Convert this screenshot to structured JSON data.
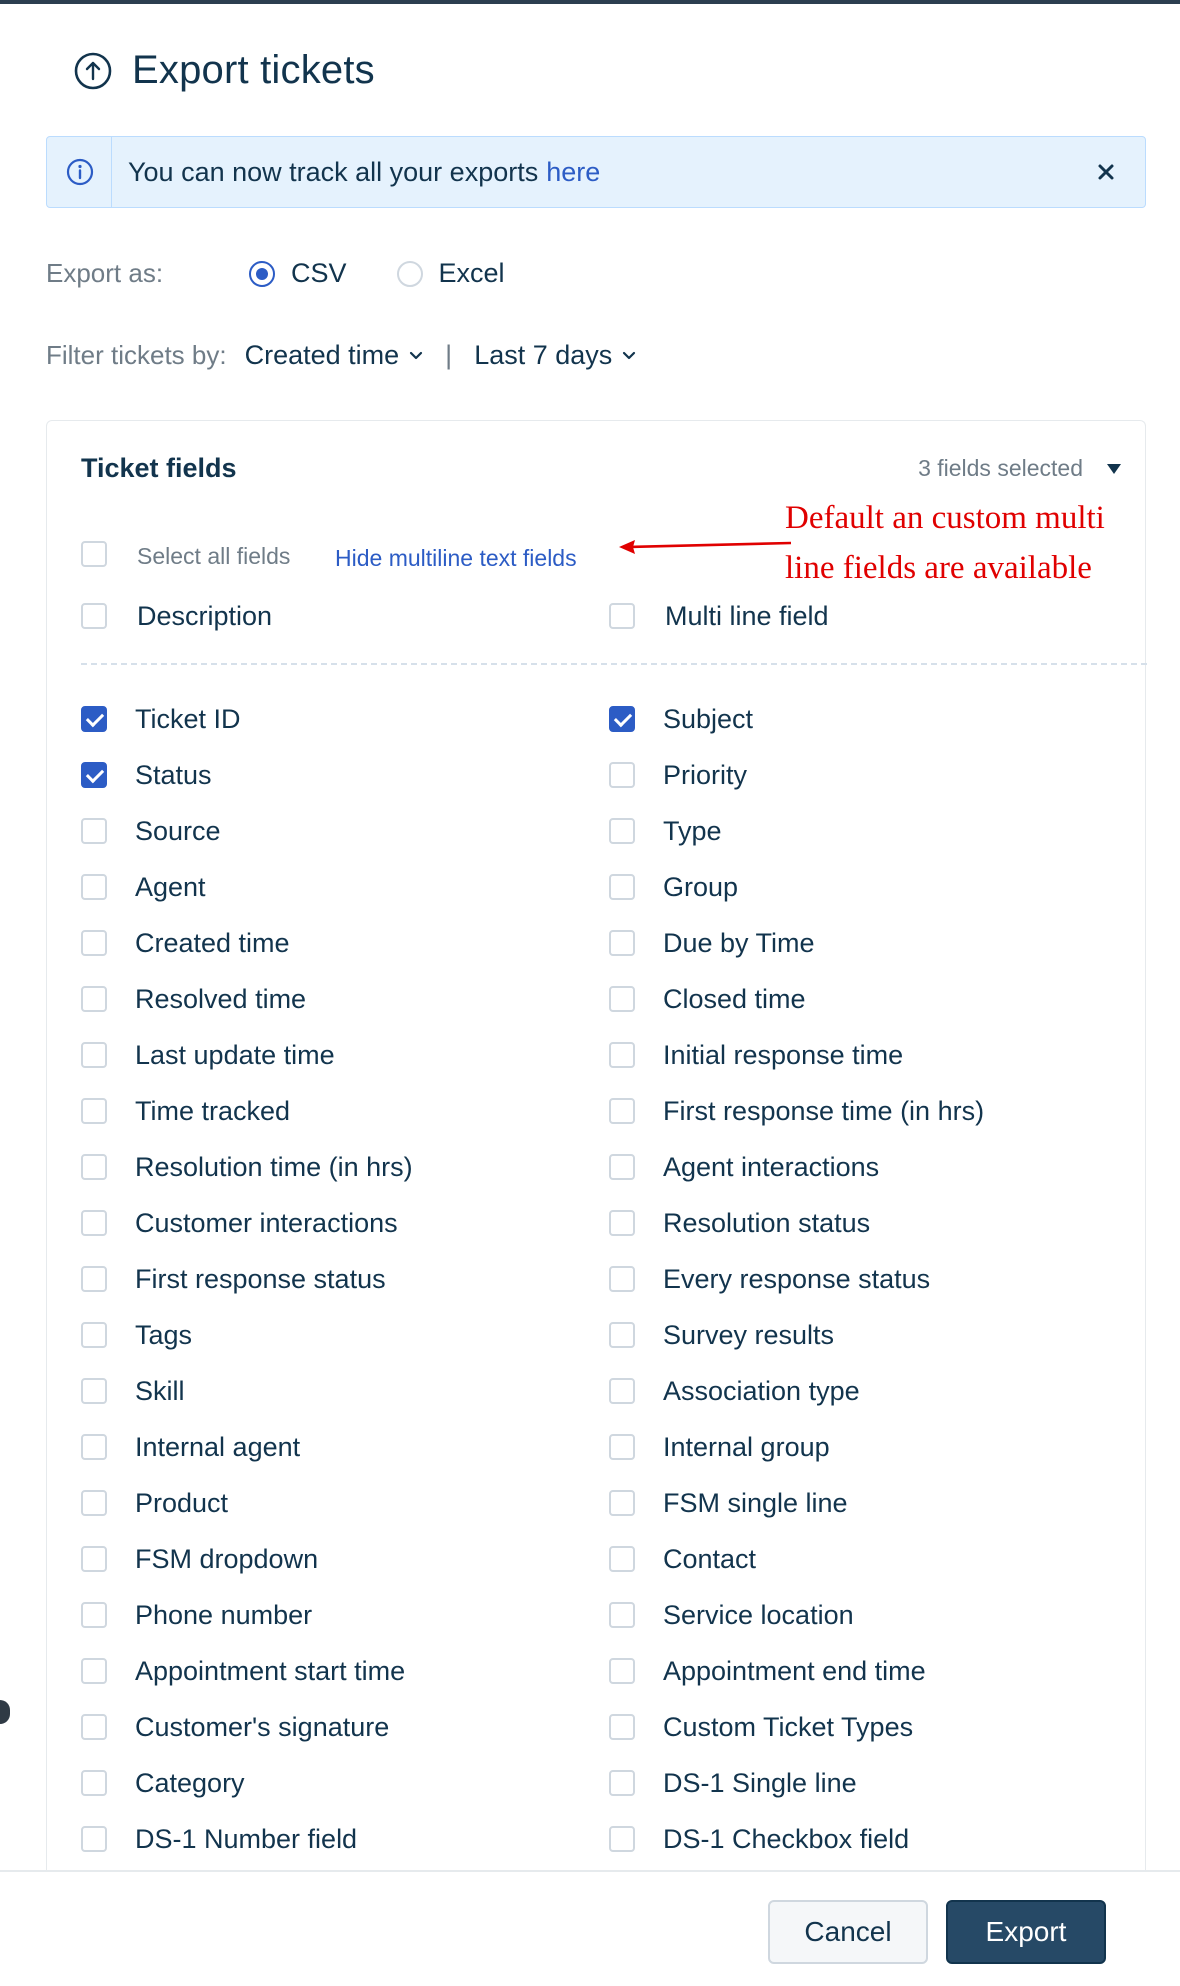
{
  "header": {
    "title": "Export tickets",
    "icon": "export-arrow-up-icon"
  },
  "banner": {
    "message": "You can now track all your exports",
    "link_text": "here",
    "info_icon": "info-icon",
    "close_icon": "close-icon"
  },
  "export_as": {
    "label": "Export as:",
    "options": [
      {
        "label": "CSV",
        "checked": true
      },
      {
        "label": "Excel",
        "checked": false
      }
    ]
  },
  "filter": {
    "label": "Filter tickets by:",
    "field_value": "Created time",
    "separator": "|",
    "range_value": "Last 7 days"
  },
  "panel": {
    "title": "Ticket fields",
    "selected_count": "3 fields selected",
    "select_all_label": "Select all fields",
    "hide_multiline_link": "Hide multiline text fields",
    "multiline_fields": [
      {
        "label": "Description",
        "checked": false
      },
      {
        "label": "Multi line field",
        "checked": false
      }
    ],
    "fields": [
      [
        {
          "label": "Ticket ID",
          "checked": true
        },
        {
          "label": "Subject",
          "checked": true
        }
      ],
      [
        {
          "label": "Status",
          "checked": true
        },
        {
          "label": "Priority",
          "checked": false
        }
      ],
      [
        {
          "label": "Source",
          "checked": false
        },
        {
          "label": "Type",
          "checked": false
        }
      ],
      [
        {
          "label": "Agent",
          "checked": false
        },
        {
          "label": "Group",
          "checked": false
        }
      ],
      [
        {
          "label": "Created time",
          "checked": false
        },
        {
          "label": "Due by Time",
          "checked": false
        }
      ],
      [
        {
          "label": "Resolved time",
          "checked": false
        },
        {
          "label": "Closed time",
          "checked": false
        }
      ],
      [
        {
          "label": "Last update time",
          "checked": false
        },
        {
          "label": "Initial response time",
          "checked": false
        }
      ],
      [
        {
          "label": "Time tracked",
          "checked": false
        },
        {
          "label": "First response time (in hrs)",
          "checked": false
        }
      ],
      [
        {
          "label": "Resolution time (in hrs)",
          "checked": false
        },
        {
          "label": "Agent interactions",
          "checked": false
        }
      ],
      [
        {
          "label": "Customer interactions",
          "checked": false
        },
        {
          "label": "Resolution status",
          "checked": false
        }
      ],
      [
        {
          "label": "First response status",
          "checked": false
        },
        {
          "label": "Every response status",
          "checked": false
        }
      ],
      [
        {
          "label": "Tags",
          "checked": false
        },
        {
          "label": "Survey results",
          "checked": false
        }
      ],
      [
        {
          "label": "Skill",
          "checked": false
        },
        {
          "label": "Association type",
          "checked": false
        }
      ],
      [
        {
          "label": "Internal agent",
          "checked": false
        },
        {
          "label": "Internal group",
          "checked": false
        }
      ],
      [
        {
          "label": "Product",
          "checked": false
        },
        {
          "label": "FSM single line",
          "checked": false
        }
      ],
      [
        {
          "label": "FSM dropdown",
          "checked": false
        },
        {
          "label": "Contact",
          "checked": false
        }
      ],
      [
        {
          "label": "Phone number",
          "checked": false
        },
        {
          "label": "Service location",
          "checked": false
        }
      ],
      [
        {
          "label": "Appointment start time",
          "checked": false
        },
        {
          "label": "Appointment end time",
          "checked": false
        }
      ],
      [
        {
          "label": "Customer's signature",
          "checked": false
        },
        {
          "label": "Custom Ticket Types",
          "checked": false
        }
      ],
      [
        {
          "label": "Category",
          "checked": false
        },
        {
          "label": "DS-1 Single line",
          "checked": false
        }
      ],
      [
        {
          "label": "DS-1 Number field",
          "checked": false
        },
        {
          "label": "DS-1 Checkbox field",
          "checked": false
        }
      ]
    ]
  },
  "annotation": {
    "text": "Default an custom multi line fields are available",
    "color": "#e00000"
  },
  "footer": {
    "cancel_label": "Cancel",
    "export_label": "Export"
  },
  "colors": {
    "accent": "#2c5cc5",
    "primary_button": "#264966",
    "text": "#12344d",
    "muted": "#6f7c87"
  }
}
